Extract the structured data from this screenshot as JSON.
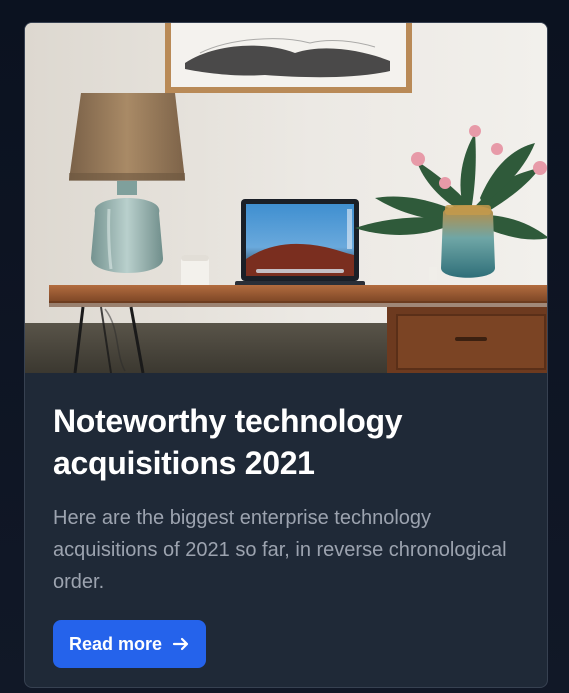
{
  "card": {
    "image_alt": "Desk with a laptop, lamp, and flowers",
    "title": "Noteworthy technology acquisitions 2021",
    "description": "Here are the biggest enterprise technology acquisitions of 2021 so far, in reverse chronological order.",
    "button_label": "Read more",
    "button_icon": "arrow-right-icon"
  },
  "colors": {
    "card_background": "#1f2937",
    "button_background": "#2563eb",
    "title_color": "#ffffff",
    "text_color": "#9ca3af"
  }
}
